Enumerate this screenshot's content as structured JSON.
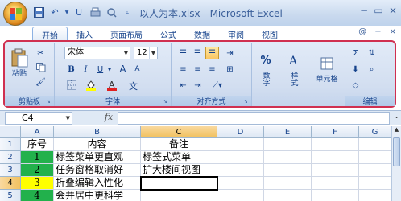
{
  "window": {
    "title": "以人为本.xlsx - Microsoft Excel",
    "controls": [
      "−",
      "▭",
      "×"
    ]
  },
  "qat": [
    "save-icon",
    "undo-icon",
    "redo-icon",
    "quickprint-icon",
    "customize-icon"
  ],
  "tabs": [
    "开始",
    "插入",
    "页面布局",
    "公式",
    "数据",
    "审阅",
    "视图"
  ],
  "tabs_right": [
    "@",
    "−",
    "×"
  ],
  "ribbon": {
    "clipboard": {
      "label": "剪贴板",
      "paste": "粘贴"
    },
    "font": {
      "label": "字体",
      "font_name": "宋体",
      "font_size": "12",
      "bold": "B",
      "italic": "I",
      "underline": "U",
      "grow": "A",
      "shrink": "A"
    },
    "alignment": {
      "label": "对齐方式"
    },
    "number": {
      "label": "数字",
      "button": "数字"
    },
    "styles": {
      "button": "样式"
    },
    "cells": {
      "button": "单元格"
    },
    "editing": {
      "label": "编辑"
    },
    "percent": "%"
  },
  "formula_bar": {
    "name_box": "C4",
    "fx": "fx",
    "formula": ""
  },
  "grid": {
    "columns": [
      "A",
      "B",
      "C",
      "D",
      "E",
      "F",
      "G"
    ],
    "selected_column": "C",
    "rows": [
      {
        "num": "1",
        "a": "序号",
        "b": "内容",
        "c": "备注"
      },
      {
        "num": "2",
        "a": "1",
        "b": "标签菜单更直观",
        "c": "标签式菜单"
      },
      {
        "num": "3",
        "a": "2",
        "b": "任务窗格取消好",
        "c": "扩大楼间视图"
      },
      {
        "num": "4",
        "a": "3",
        "b": "折叠编辑入性化",
        "c": ""
      },
      {
        "num": "5",
        "a": "4",
        "b": "会并居中更科学",
        "c": ""
      }
    ],
    "selected_row": "4",
    "colors": {
      "green": "#22b14c",
      "yellow": "#ffff00"
    }
  },
  "accent": {
    "ribbon_highlight": "#d03050",
    "selection": "#f1c15f"
  }
}
